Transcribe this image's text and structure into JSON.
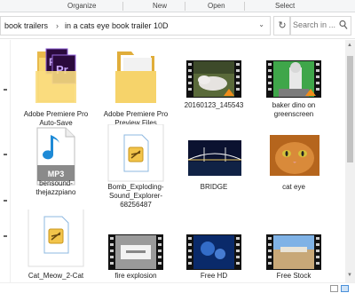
{
  "ribbon": {
    "groups": [
      "Organize",
      "New",
      "Open",
      "Select"
    ]
  },
  "address": {
    "crumbs": [
      "book trailers",
      "in a cats eye book trailer 10D"
    ],
    "search_placeholder": "Search in ..."
  },
  "items": [
    {
      "label": "Adobe Premiere Pro Auto-Save",
      "kind": "folder-premiere"
    },
    {
      "label": "Adobe Premiere Pro Preview Files",
      "kind": "folder-plain"
    },
    {
      "label": "20160123_145543",
      "kind": "video-thumb"
    },
    {
      "label": "baker dino on greenscreen",
      "kind": "video-thumb"
    },
    {
      "label": "bensound-thejazzpiano",
      "kind": "mp3-file",
      "badge": "MP3"
    },
    {
      "label": "Bomb_Exploding-Sound_Explorer-68256487",
      "kind": "audio-file"
    },
    {
      "label": "BRIDGE",
      "kind": "image-thumb"
    },
    {
      "label": "cat eye",
      "kind": "image-thumb"
    },
    {
      "label": "Cat_Meow_2-Cat",
      "kind": "audio-file"
    },
    {
      "label": "fire explosion",
      "kind": "video-thumb"
    },
    {
      "label": "Free HD",
      "kind": "video-thumb"
    },
    {
      "label": "Free Stock",
      "kind": "video-thumb"
    }
  ]
}
